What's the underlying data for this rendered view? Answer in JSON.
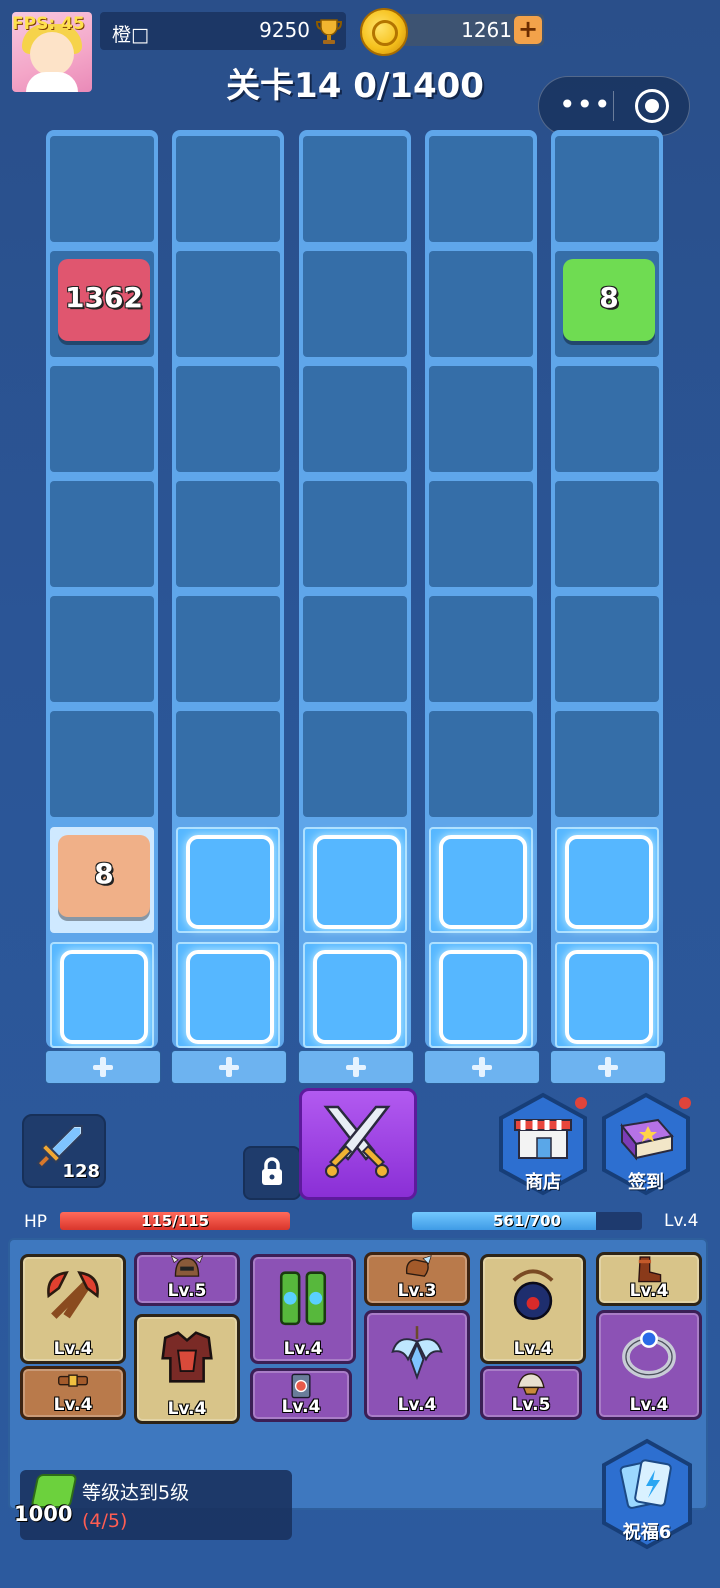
{
  "hud": {
    "fps_text": "FPS: 45",
    "player_name": "橙□",
    "trophy_score": "9250",
    "coins": "1261",
    "level_title": "关卡14 0/1400",
    "menu_dots": "•••"
  },
  "columns": [
    {
      "slots": 8,
      "tiles": [
        {
          "row": 1,
          "value": "1362",
          "color": "#e0566f"
        },
        {
          "row": 6,
          "value": "8",
          "color": "#f0b088"
        }
      ]
    },
    {
      "slots": 8,
      "tiles": []
    },
    {
      "slots": 8,
      "tiles": []
    },
    {
      "slots": 8,
      "tiles": []
    },
    {
      "slots": 8,
      "tiles": [
        {
          "row": 1,
          "value": "8",
          "color": "#6fdc52"
        }
      ]
    }
  ],
  "controls": {
    "sword_count": "128",
    "shop_label": "商店",
    "signin_label": "签到",
    "bless_label": "祝福6"
  },
  "stats": {
    "hp_label": "HP",
    "hp_text": "115/115",
    "hp_fraction": 1.0,
    "xp_text": "561/700",
    "xp_fraction": 0.8,
    "level_text": "Lv.4"
  },
  "inventory": [
    {
      "icon": "axe-icon",
      "level": "Lv.4",
      "rarity": "gold"
    },
    {
      "icon": "belt-icon",
      "level": "Lv.4",
      "rarity": "brown"
    },
    {
      "icon": "helmet-icon",
      "level": "Lv.5",
      "rarity": "purple"
    },
    {
      "icon": "armor-icon",
      "level": "Lv.4",
      "rarity": "gold"
    },
    {
      "icon": "pants-icon",
      "level": "Lv.4",
      "rarity": "purple"
    },
    {
      "icon": "rune-card-icon",
      "level": "Lv.4",
      "rarity": "purple"
    },
    {
      "icon": "glove-icon",
      "level": "Lv.3",
      "rarity": "brown"
    },
    {
      "icon": "wing-amulet-icon",
      "level": "Lv.4",
      "rarity": "purple"
    },
    {
      "icon": "bomb-necklace-icon",
      "level": "Lv.4",
      "rarity": "gold"
    },
    {
      "icon": "shoulder-icon",
      "level": "Lv.5",
      "rarity": "purple"
    },
    {
      "icon": "boots-icon",
      "level": "Lv.4",
      "rarity": "gold"
    },
    {
      "icon": "ring-icon",
      "level": "Lv.4",
      "rarity": "purple"
    }
  ],
  "quest": {
    "cost": "1000",
    "title": "等级达到5级",
    "progress": "(4/5)"
  },
  "colors": {
    "background": "#2b5596",
    "column": "#5fa6ea",
    "hp": "#d9362c",
    "xp": "#3f9be6",
    "accent_purple": "#8a2fd6"
  }
}
